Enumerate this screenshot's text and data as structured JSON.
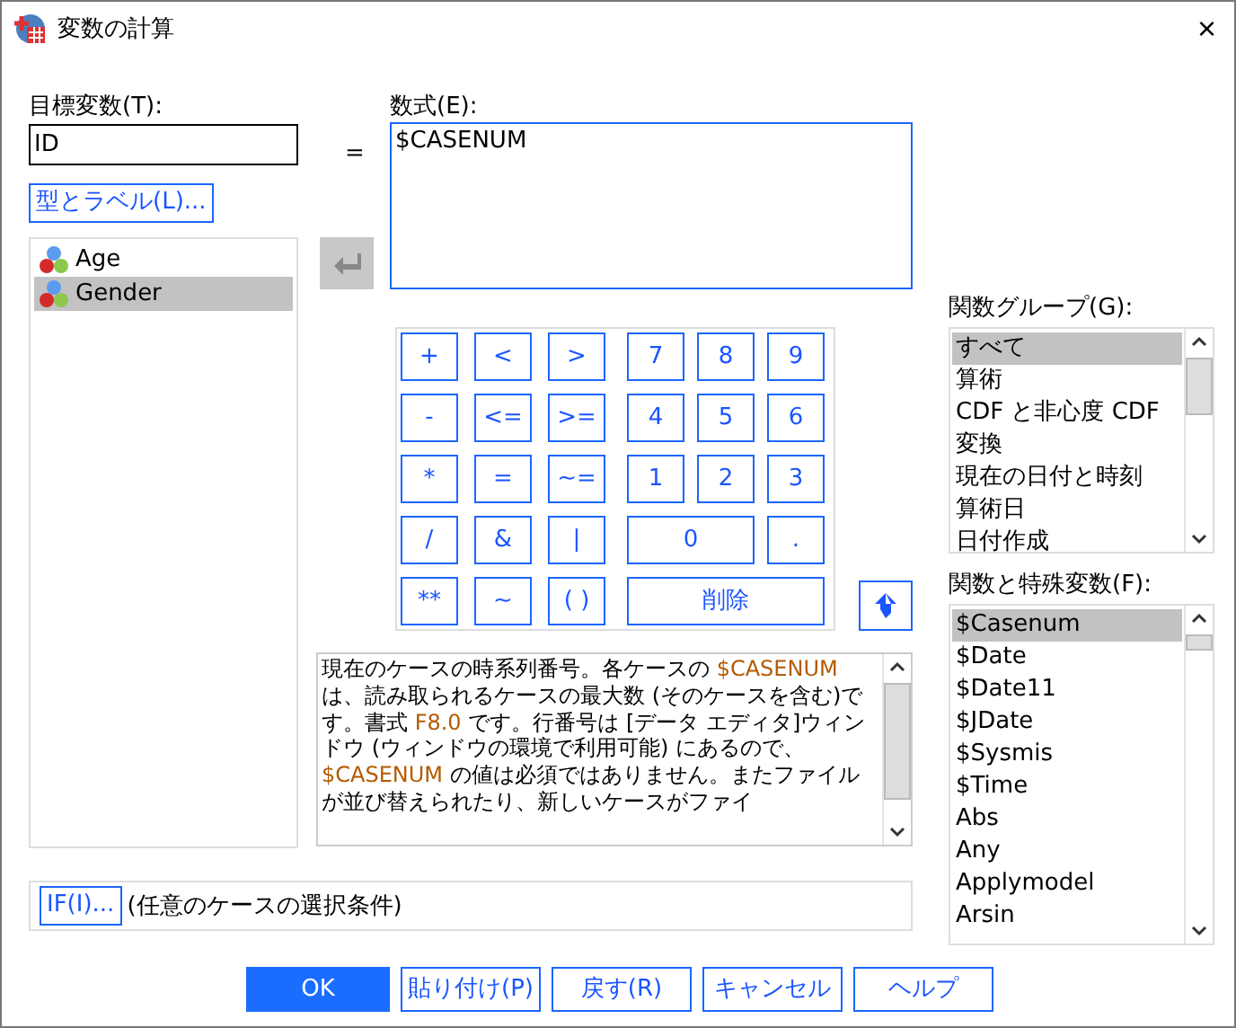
{
  "window": {
    "title": "変数の計算",
    "close": "×"
  },
  "target": {
    "label": "目標変数(T):",
    "value": "ID",
    "type_button": "型とラベル(L)..."
  },
  "variables": [
    {
      "name": "Age",
      "selected": false
    },
    {
      "name": "Gender",
      "selected": true
    }
  ],
  "equals": "=",
  "transfer_button": {
    "disabled": true
  },
  "expression": {
    "label": "数式(E):",
    "value": "$CASENUM"
  },
  "keypad": {
    "operators": [
      "+",
      "<",
      ">",
      "-",
      "<=",
      ">=",
      "*",
      "=",
      "~=",
      "/",
      "&",
      "|",
      "**",
      "~",
      "( )"
    ],
    "digits": [
      {
        "label": "7",
        "kind": "single"
      },
      {
        "label": "8",
        "kind": "single"
      },
      {
        "label": "9",
        "kind": "single"
      },
      {
        "label": "4",
        "kind": "single"
      },
      {
        "label": "5",
        "kind": "single"
      },
      {
        "label": "6",
        "kind": "single"
      },
      {
        "label": "1",
        "kind": "single"
      },
      {
        "label": "2",
        "kind": "single"
      },
      {
        "label": "3",
        "kind": "single"
      },
      {
        "label": "0",
        "kind": "double"
      },
      {
        "label": ".",
        "kind": "single"
      },
      {
        "label": "削除",
        "kind": "triple"
      }
    ]
  },
  "description": [
    {
      "text": "現在のケースの時系列番号。各ケースの ",
      "kind": "plain"
    },
    {
      "text": "$CASENUM",
      "kind": "code"
    },
    {
      "text": "は、読み取られるケースの最大数 (そのケースを含む)です。書式 ",
      "kind": "plain"
    },
    {
      "text": "F8.0",
      "kind": "code"
    },
    {
      "text": " です。行番号は [データ エディタ]ウィンドウ (ウィンドウの環境で利用可能) にあるので、",
      "kind": "plain"
    },
    {
      "text": "$CASENUM",
      "kind": "code"
    },
    {
      "text": " の値は必須ではありません。またファイルが並び替えられたり、新しいケースがファイ",
      "kind": "plain"
    }
  ],
  "if_row": {
    "button": "IF(I)...",
    "text": "(任意のケースの選択条件)"
  },
  "function_groups": {
    "label": "関数グループ(G):",
    "items": [
      {
        "name": "すべて",
        "selected": true
      },
      {
        "name": "算術",
        "selected": false
      },
      {
        "name": "CDF と非心度 CDF",
        "selected": false
      },
      {
        "name": "変換",
        "selected": false
      },
      {
        "name": "現在の日付と時刻",
        "selected": false
      },
      {
        "name": "算術日",
        "selected": false
      },
      {
        "name": "日付作成",
        "selected": false
      }
    ]
  },
  "functions": {
    "label": "関数と特殊変数(F):",
    "items": [
      {
        "name": "$Casenum",
        "selected": true
      },
      {
        "name": "$Date",
        "selected": false
      },
      {
        "name": "$Date11",
        "selected": false
      },
      {
        "name": "$JDate",
        "selected": false
      },
      {
        "name": "$Sysmis",
        "selected": false
      },
      {
        "name": "$Time",
        "selected": false
      },
      {
        "name": "Abs",
        "selected": false
      },
      {
        "name": "Any",
        "selected": false
      },
      {
        "name": "Applymodel",
        "selected": false
      },
      {
        "name": "Arsin",
        "selected": false
      }
    ]
  },
  "buttons": [
    {
      "label": "OK",
      "default": true
    },
    {
      "label": "貼り付け(P)",
      "default": false
    },
    {
      "label": "戻す(R)",
      "default": false
    },
    {
      "label": "キャンセル",
      "default": false
    },
    {
      "label": "ヘルプ",
      "default": false
    }
  ]
}
